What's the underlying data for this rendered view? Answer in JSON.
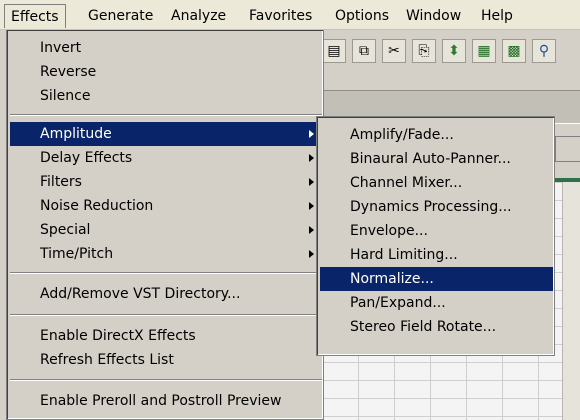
{
  "menubar": {
    "items": [
      "Effects",
      "Generate",
      "Analyze",
      "Favorites",
      "Options",
      "Window",
      "Help"
    ]
  },
  "effects_menu": {
    "group1": [
      "Invert",
      "Reverse",
      "Silence"
    ],
    "group2": [
      "Amplitude",
      "Delay Effects",
      "Filters",
      "Noise Reduction",
      "Special",
      "Time/Pitch"
    ],
    "group3": [
      "Add/Remove VST Directory..."
    ],
    "group4": [
      "Enable DirectX Effects",
      "Refresh Effects List"
    ],
    "group5": [
      "Enable Preroll and Postroll Preview"
    ],
    "highlighted": "Amplitude"
  },
  "amplitude_submenu": {
    "items": [
      "Amplify/Fade...",
      "Binaural Auto-Panner...",
      "Channel Mixer...",
      "Dynamics Processing...",
      "Envelope...",
      "Hard Limiting...",
      "Normalize...",
      "Pan/Expand...",
      "Stereo Field Rotate..."
    ],
    "highlighted": "Normalize..."
  },
  "colors": {
    "menu_highlight": "#0a246a",
    "menu_bg": "#d4d0c8",
    "menubar_bg": "#ece9d8"
  }
}
